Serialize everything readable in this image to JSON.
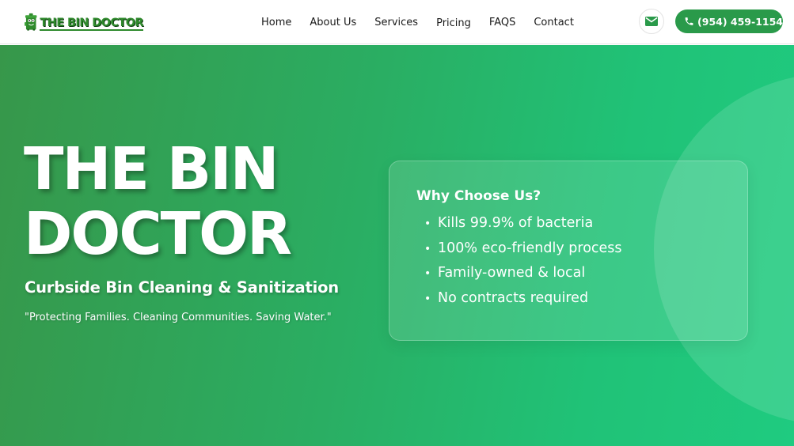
{
  "brand": {
    "name": "THE BIN DOCTOR"
  },
  "nav": {
    "items": [
      {
        "label": "Home"
      },
      {
        "label": "About Us"
      },
      {
        "label": "Services"
      },
      {
        "label": "Pricing"
      },
      {
        "label": "FAQS"
      },
      {
        "label": "Contact"
      }
    ]
  },
  "contact": {
    "mail_icon": "mail-icon",
    "phone_icon": "phone-icon",
    "phone_label": "(954) 459-1154"
  },
  "hero": {
    "title_line1": "THE BIN",
    "title_line2": "DOCTOR",
    "subtitle": "Curbside Bin Cleaning & Sanitization",
    "quote": "\"Protecting Families. Cleaning Communities. Saving Water.\""
  },
  "why": {
    "title": "Why Choose Us?",
    "bullet": "•",
    "items": [
      "Kills 99.9% of bacteria",
      "100% eco-friendly process",
      "Family-owned & local",
      "No contracts required"
    ]
  },
  "colors": {
    "brand_green": "#2f8a2c",
    "button_green": "#2a9a4a",
    "hero_start": "#37974a",
    "hero_end": "#1fcb80"
  }
}
